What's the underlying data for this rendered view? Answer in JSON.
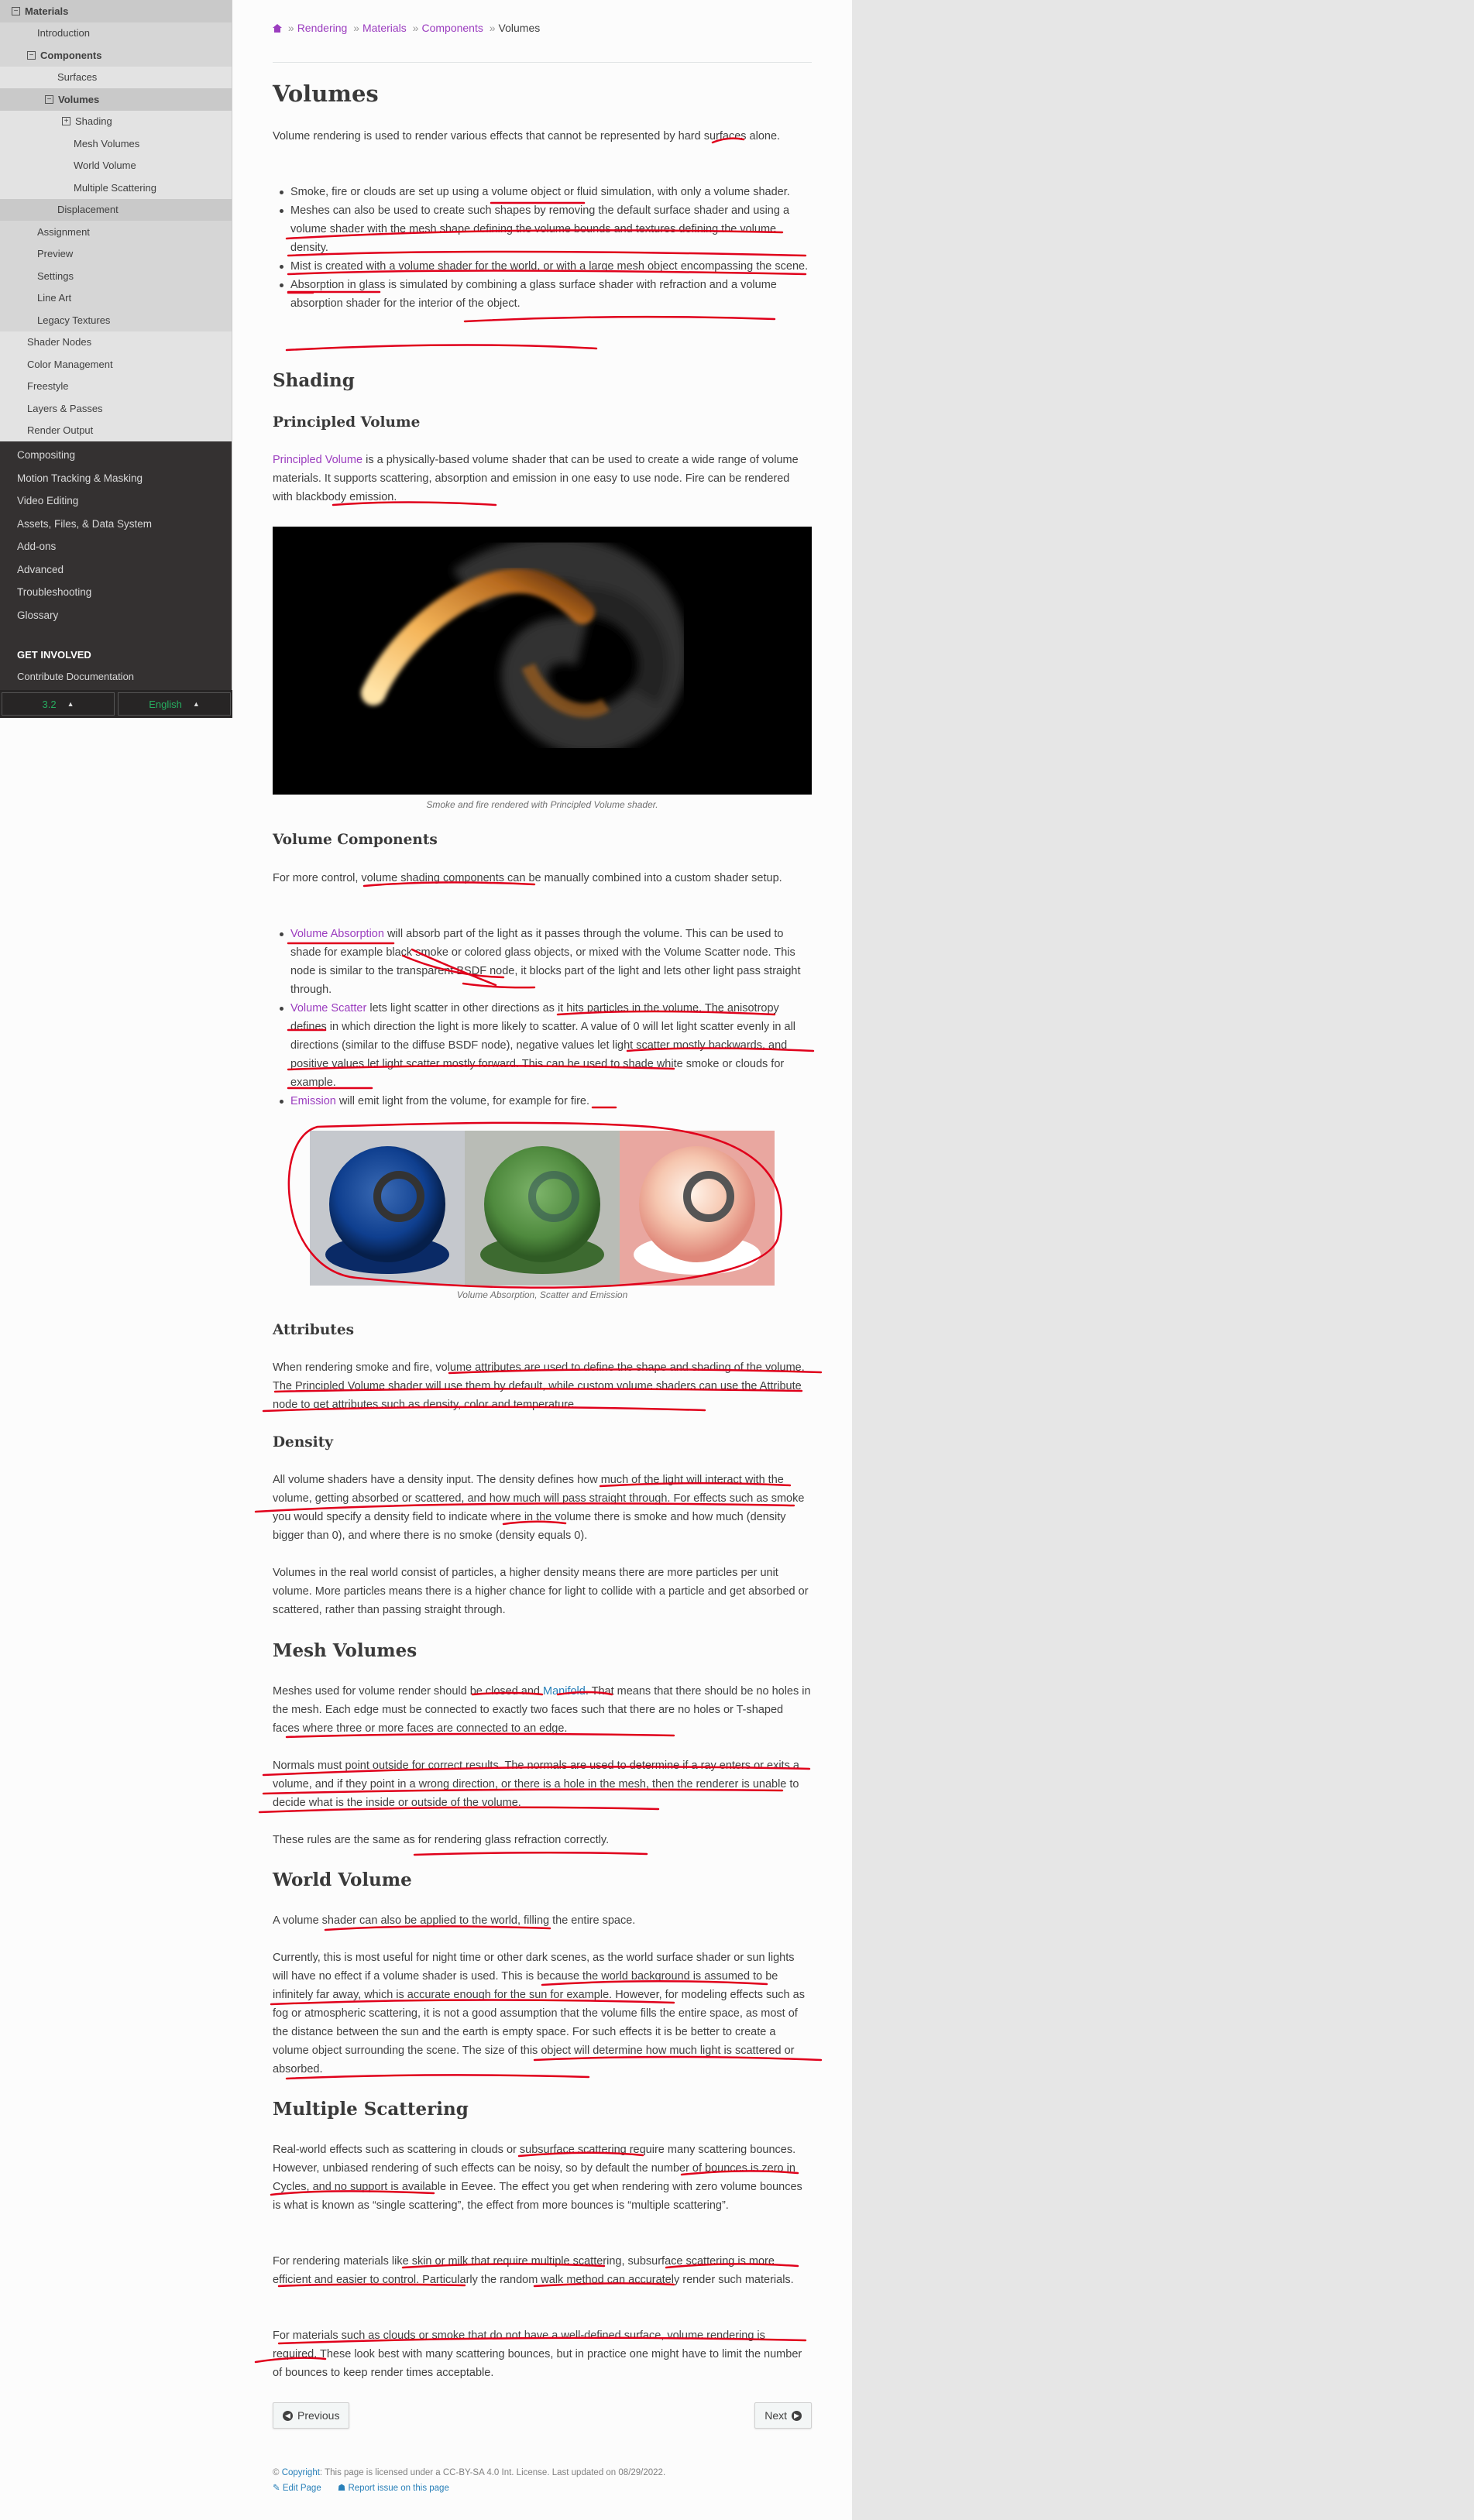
{
  "sidebar": {
    "light_items": [
      {
        "label": "Materials",
        "cls": "l1",
        "expander": "⊟"
      },
      {
        "label": "Introduction",
        "cls": "l2"
      },
      {
        "label": "Components",
        "cls": "l2b",
        "expander": "⊟"
      },
      {
        "label": "Surfaces",
        "cls": "l3"
      },
      {
        "label": "Volumes",
        "cls": "l3b",
        "expander": "⊟"
      },
      {
        "label": "Shading",
        "cls": "l4",
        "expander": "⊞"
      },
      {
        "label": "Mesh Volumes",
        "cls": "l5"
      },
      {
        "label": "World Volume",
        "cls": "l5"
      },
      {
        "label": "Multiple Scattering",
        "cls": "l5"
      },
      {
        "label": "Displacement",
        "cls": "l3d"
      },
      {
        "label": "Assignment",
        "cls": "l2"
      },
      {
        "label": "Preview",
        "cls": "l2"
      },
      {
        "label": "Settings",
        "cls": "l2"
      },
      {
        "label": "Line Art",
        "cls": "l2"
      },
      {
        "label": "Legacy Textures",
        "cls": "l2"
      },
      {
        "label": "Shader Nodes",
        "cls": "top"
      },
      {
        "label": "Color Management",
        "cls": "top"
      },
      {
        "label": "Freestyle",
        "cls": "top"
      },
      {
        "label": "Layers & Passes",
        "cls": "top"
      },
      {
        "label": "Render Output",
        "cls": "top"
      }
    ],
    "dark_items": [
      "Compositing",
      "Motion Tracking & Masking",
      "Video Editing",
      "Assets, Files, & Data System",
      "Add-ons",
      "Advanced",
      "Troubleshooting",
      "Glossary"
    ],
    "get_involved": "GET INVOLVED",
    "contribute": "Contribute Documentation",
    "version": "3.2",
    "language": "English"
  },
  "breadcrumb": {
    "items": [
      "Rendering",
      "Materials",
      "Components"
    ],
    "current": "Volumes"
  },
  "page_title": "Volumes",
  "intro": "Volume rendering is used to render various effects that cannot be represented by hard surfaces alone.",
  "intro_list": [
    "Smoke, fire or clouds are set up using a volume object or fluid simulation, with only a volume shader.",
    "Meshes can also be used to create such shapes by removing the default surface shader and using a volume shader with the mesh shape defining the volume bounds and textures defining the volume density.",
    "Mist is created with a volume shader for the world, or with a large mesh object encompassing the scene.",
    "Absorption in glass is simulated by combining a glass surface shader with refraction and a volume absorption shader for the interior of the object."
  ],
  "shading": {
    "title": "Shading",
    "principled_title": "Principled Volume",
    "principled_link": "Principled Volume",
    "principled_text": " is a physically-based volume shader that can be used to create a wide range of volume materials. It supports scattering, absorption and emission in one easy to use node. Fire can be rendered with blackbody emission.",
    "smoke_caption": "Smoke and fire rendered with Principled Volume shader.",
    "components_title": "Volume Components",
    "components_text": "For more control, volume shading components can be manually combined into a custom shader setup.",
    "components_list": [
      {
        "link": "Volume Absorption",
        "text": " will absorb part of the light as it passes through the volume. This can be used to shade for example black smoke or colored glass objects, or mixed with the Volume Scatter node. This node is similar to the transparent BSDF node, it blocks part of the light and lets other light pass straight through."
      },
      {
        "link": "Volume Scatter",
        "text": " lets light scatter in other directions as it hits particles in the volume. The anisotropy defines in which direction the light is more likely to scatter. A value of 0 will let light scatter evenly in all directions (similar to the diffuse BSDF node), negative values let light scatter mostly backwards, and positive values let light scatter mostly forward. This can be used to shade white smoke or clouds for example."
      },
      {
        "link": "Emission",
        "text": " will emit light from the volume, for example for fire."
      }
    ],
    "spheres_caption": "Volume Absorption, Scatter and Emission"
  },
  "attributes": {
    "title": "Attributes",
    "text": "When rendering smoke and fire, volume attributes are used to define the shape and shading of the volume. The Principled Volume shader will use them by default, while custom volume shaders can use the Attribute node to get attributes such as density, color and temperature."
  },
  "density": {
    "title": "Density",
    "p1": "All volume shaders have a density input. The density defines how much of the light will interact with the volume, getting absorbed or scattered, and how much will pass straight through. For effects such as smoke you would specify a density field to indicate where in the volume there is smoke and how much (density bigger than 0), and where there is no smoke (density equals 0).",
    "p2": "Volumes in the real world consist of particles, a higher density means there are more particles per unit volume. More particles means there is a higher chance for light to collide with a particle and get absorbed or scattered, rather than passing straight through."
  },
  "mesh_volumes": {
    "title": "Mesh Volumes",
    "p1_a": "Meshes used for volume render should be closed and ",
    "p1_link": "Manifold",
    "p1_b": ". That means that there should be no holes in the mesh. Each edge must be connected to exactly two faces such that there are no holes or T-shaped faces where three or more faces are connected to an edge.",
    "p2": "Normals must point outside for correct results. The normals are used to determine if a ray enters or exits a volume, and if they point in a wrong direction, or there is a hole in the mesh, then the renderer is unable to decide what is the inside or outside of the volume.",
    "p3": "These rules are the same as for rendering glass refraction correctly."
  },
  "world_volume": {
    "title": "World Volume",
    "p1": "A volume shader can also be applied to the world, filling the entire space.",
    "p2": "Currently, this is most useful for night time or other dark scenes, as the world surface shader or sun lights will have no effect if a volume shader is used. This is because the world background is assumed to be infinitely far away, which is accurate enough for the sun for example. However, for modeling effects such as fog or atmospheric scattering, it is not a good assumption that the volume fills the entire space, as most of the distance between the sun and the earth is empty space. For such effects it is be better to create a volume object surrounding the scene. The size of this object will determine how much light is scattered or absorbed."
  },
  "multiple_scattering": {
    "title": "Multiple Scattering",
    "p1": "Real-world effects such as scattering in clouds or subsurface scattering require many scattering bounces. However, unbiased rendering of such effects can be noisy, so by default the number of bounces is zero in Cycles, and no support is available in Eevee. The effect you get when rendering with zero volume bounces is what is known as “single scattering”, the effect from more bounces is “multiple scattering”.",
    "p2": "For rendering materials like skin or milk that require multiple scattering, subsurface scattering is more efficient and easier to control. Particularly the random walk method can accurately render such materials.",
    "p3": "For materials such as clouds or smoke that do not have a well-defined surface, volume rendering is required. These look best with many scattering bounces, but in practice one might have to limit the number of bounces to keep render times acceptable."
  },
  "nav": {
    "previous": "Previous",
    "next": "Next"
  },
  "footer": {
    "copyright_symbol": "©",
    "copyright_link": "Copyright",
    "license_text": ": This page is licensed under a CC-BY-SA 4.0 Int. License. Last updated on 08/29/2022.",
    "edit_page": "Edit Page",
    "report_issue": "Report issue on this page"
  },
  "colors": {
    "link": "#9b3dbf",
    "sidebar_dark": "#343131",
    "annotation_red": "#e0001b",
    "version_green": "#27ae60"
  }
}
